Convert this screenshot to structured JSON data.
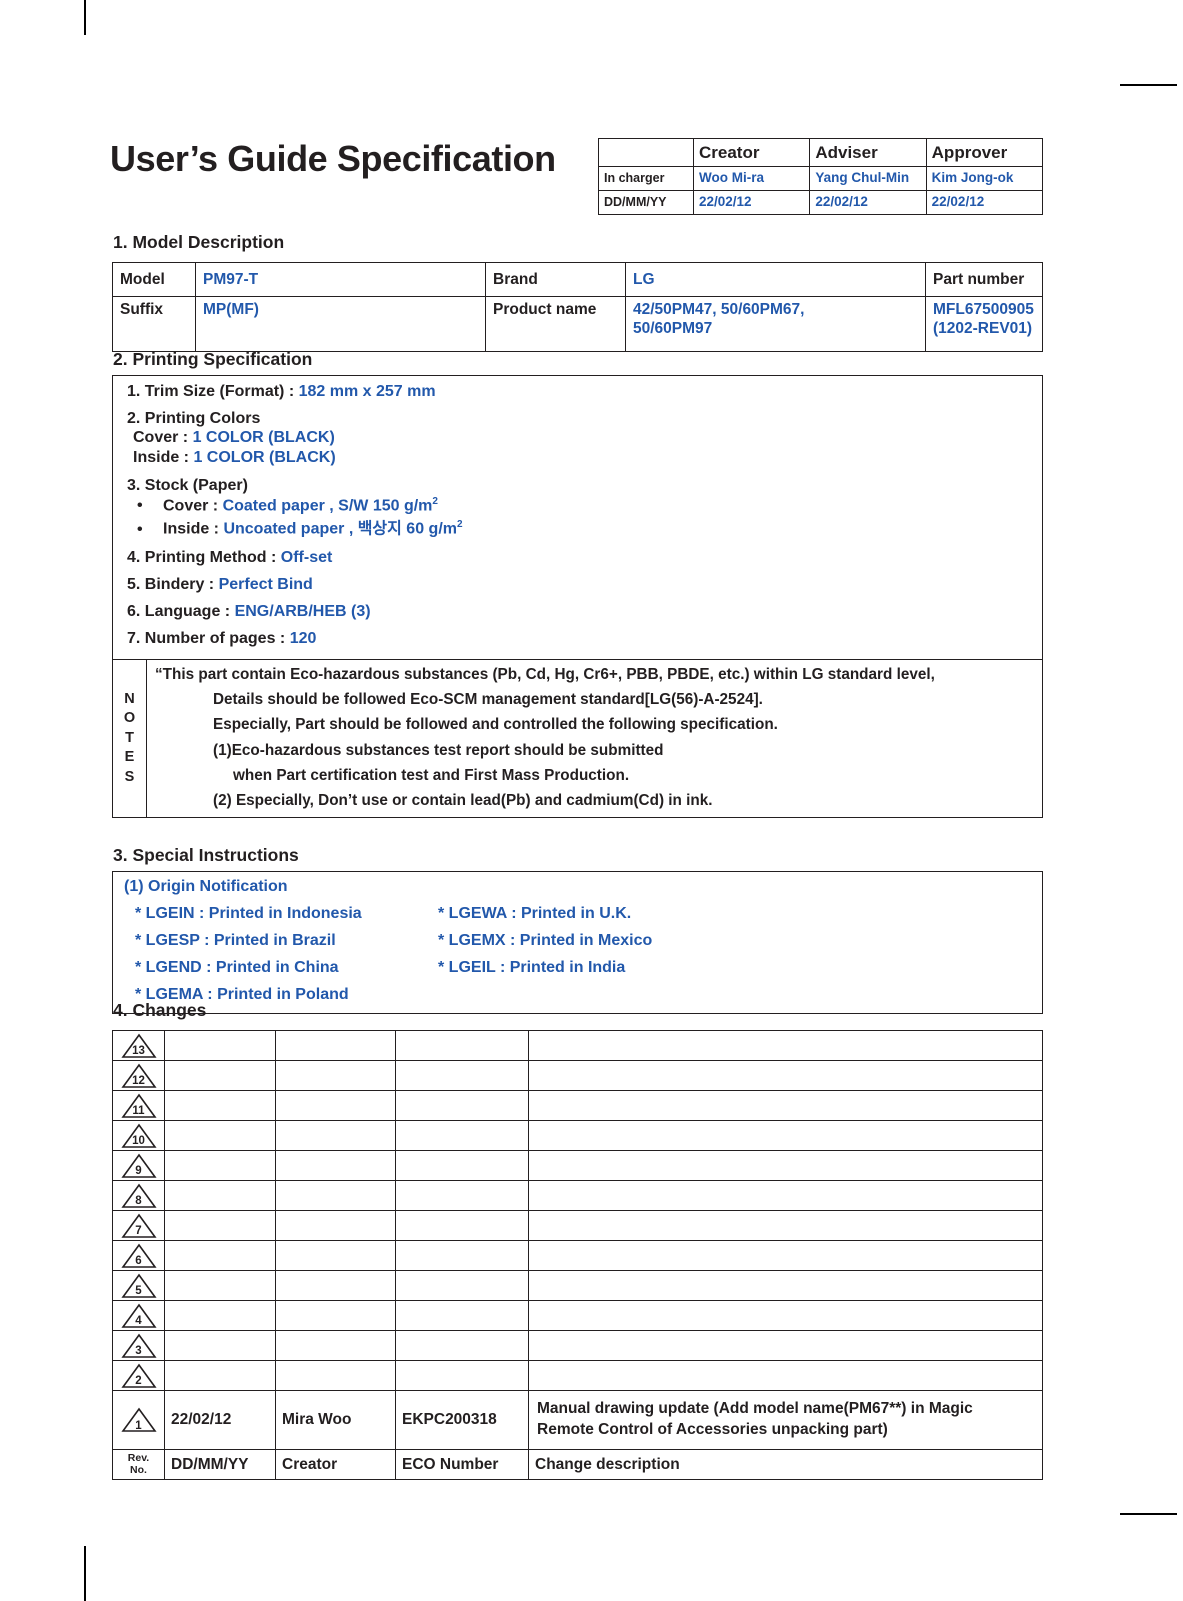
{
  "document": {
    "title": "User’s Guide Specification"
  },
  "approver_table": {
    "columns": [
      "",
      "Creator",
      "Adviser",
      "Approver"
    ],
    "rows": [
      {
        "label": "In charger",
        "values": [
          "Woo Mi-ra",
          "Yang Chul-Min",
          "Kim Jong-ok"
        ]
      },
      {
        "label": "DD/MM/YY",
        "values": [
          "22/02/12",
          "22/02/12",
          "22/02/12"
        ]
      }
    ]
  },
  "sections": {
    "model": {
      "heading": "1. Model Description"
    },
    "printing": {
      "heading": "2. Printing Specification"
    },
    "special": {
      "heading": "3. Special Instructions"
    },
    "changes": {
      "heading": "4. Changes"
    }
  },
  "model_description": {
    "model_label": "Model",
    "model_value": "PM97-T",
    "brand_label": "Brand",
    "brand_value": "LG",
    "part_number_label": "Part number",
    "suffix_label": "Suffix",
    "suffix_value": "MP(MF)",
    "product_name_label": "Product name",
    "product_name_line1": "42/50PM47, 50/60PM67,",
    "product_name_line2": "50/60PM97",
    "part_number_value": "MFL67500905",
    "part_number_rev": "(1202-REV01)"
  },
  "printing_specification": {
    "trim_size_label": "1. Trim Size (Format) : ",
    "trim_size_value": "182 mm x 257 mm",
    "printing_colors_label": "2. Printing Colors",
    "cover_color_label": "Cover : ",
    "cover_color_value": "1 COLOR (BLACK)",
    "inside_color_label": "Inside : ",
    "inside_color_value": "1 COLOR (BLACK)",
    "stock_label": "3. Stock (Paper)",
    "stock_cover_label": "Cover : ",
    "stock_cover_value": "Coated paper , S/W 150 g/m",
    "stock_cover_sup": "2",
    "stock_inside_label": "Inside : ",
    "stock_inside_value": "Uncoated paper , 백상지 60 g/m",
    "stock_inside_sup": "2",
    "printing_method_label": "4. Printing Method : ",
    "printing_method_value": "Off-set",
    "bindery_label": "5. Bindery  : ",
    "bindery_value": "Perfect Bind",
    "language_label": "6. Language : ",
    "language_value": "ENG/ARB/HEB (3)",
    "pages_label": "7. Number of pages : ",
    "pages_value": "120",
    "bullet_glyph": "•"
  },
  "notes": {
    "label_letters": [
      "N",
      "O",
      "T",
      "E",
      "S"
    ],
    "lines": [
      "“This part contain Eco-hazardous substances (Pb, Cd, Hg, Cr6+, PBB, PBDE, etc.) within LG standard level,",
      "Details should be followed Eco-SCM management standard[LG(56)-A-2524].",
      "Especially, Part should be followed and controlled the following specification.",
      "(1)Eco-hazardous substances test report should be submitted",
      "when  Part certification test and First Mass Production.",
      "(2) Especially, Don’t use or contain lead(Pb) and cadmium(Cd) in ink."
    ]
  },
  "special_instructions": {
    "heading_line": "(1) Origin Notification",
    "pairs": [
      {
        "left": "* LGEIN : Printed in Indonesia",
        "right": "* LGEWA : Printed in U.K."
      },
      {
        "left": "* LGESP : Printed in Brazil",
        "right": "* LGEMX : Printed in Mexico"
      },
      {
        "left": "* LGEND : Printed in China",
        "right": "* LGEIL : Printed in India"
      },
      {
        "left": "* LGEMA : Printed in Poland",
        "right": ""
      }
    ]
  },
  "changes": {
    "empty_revisions": [
      "13",
      "12",
      "11",
      "10",
      "9",
      "8",
      "7",
      "6",
      "5",
      "4",
      "3",
      "2"
    ],
    "entries": [
      {
        "rev": "1",
        "date": "22/02/12",
        "creator": "Mira Woo",
        "eco_number": "EKPC200318",
        "description_line1": "Manual drawing update (Add model name(PM67**) in Magic",
        "description_line2": "Remote Control of Accessories unpacking part)"
      }
    ],
    "footer": {
      "rev_no_line1": "Rev.",
      "rev_no_line2": "No.",
      "date": "DD/MM/YY",
      "creator": "Creator",
      "eco_number": "ECO Number",
      "description": "Change description"
    }
  },
  "colors": {
    "accent_blue": "#2258ab",
    "text_black": "#231f20"
  }
}
